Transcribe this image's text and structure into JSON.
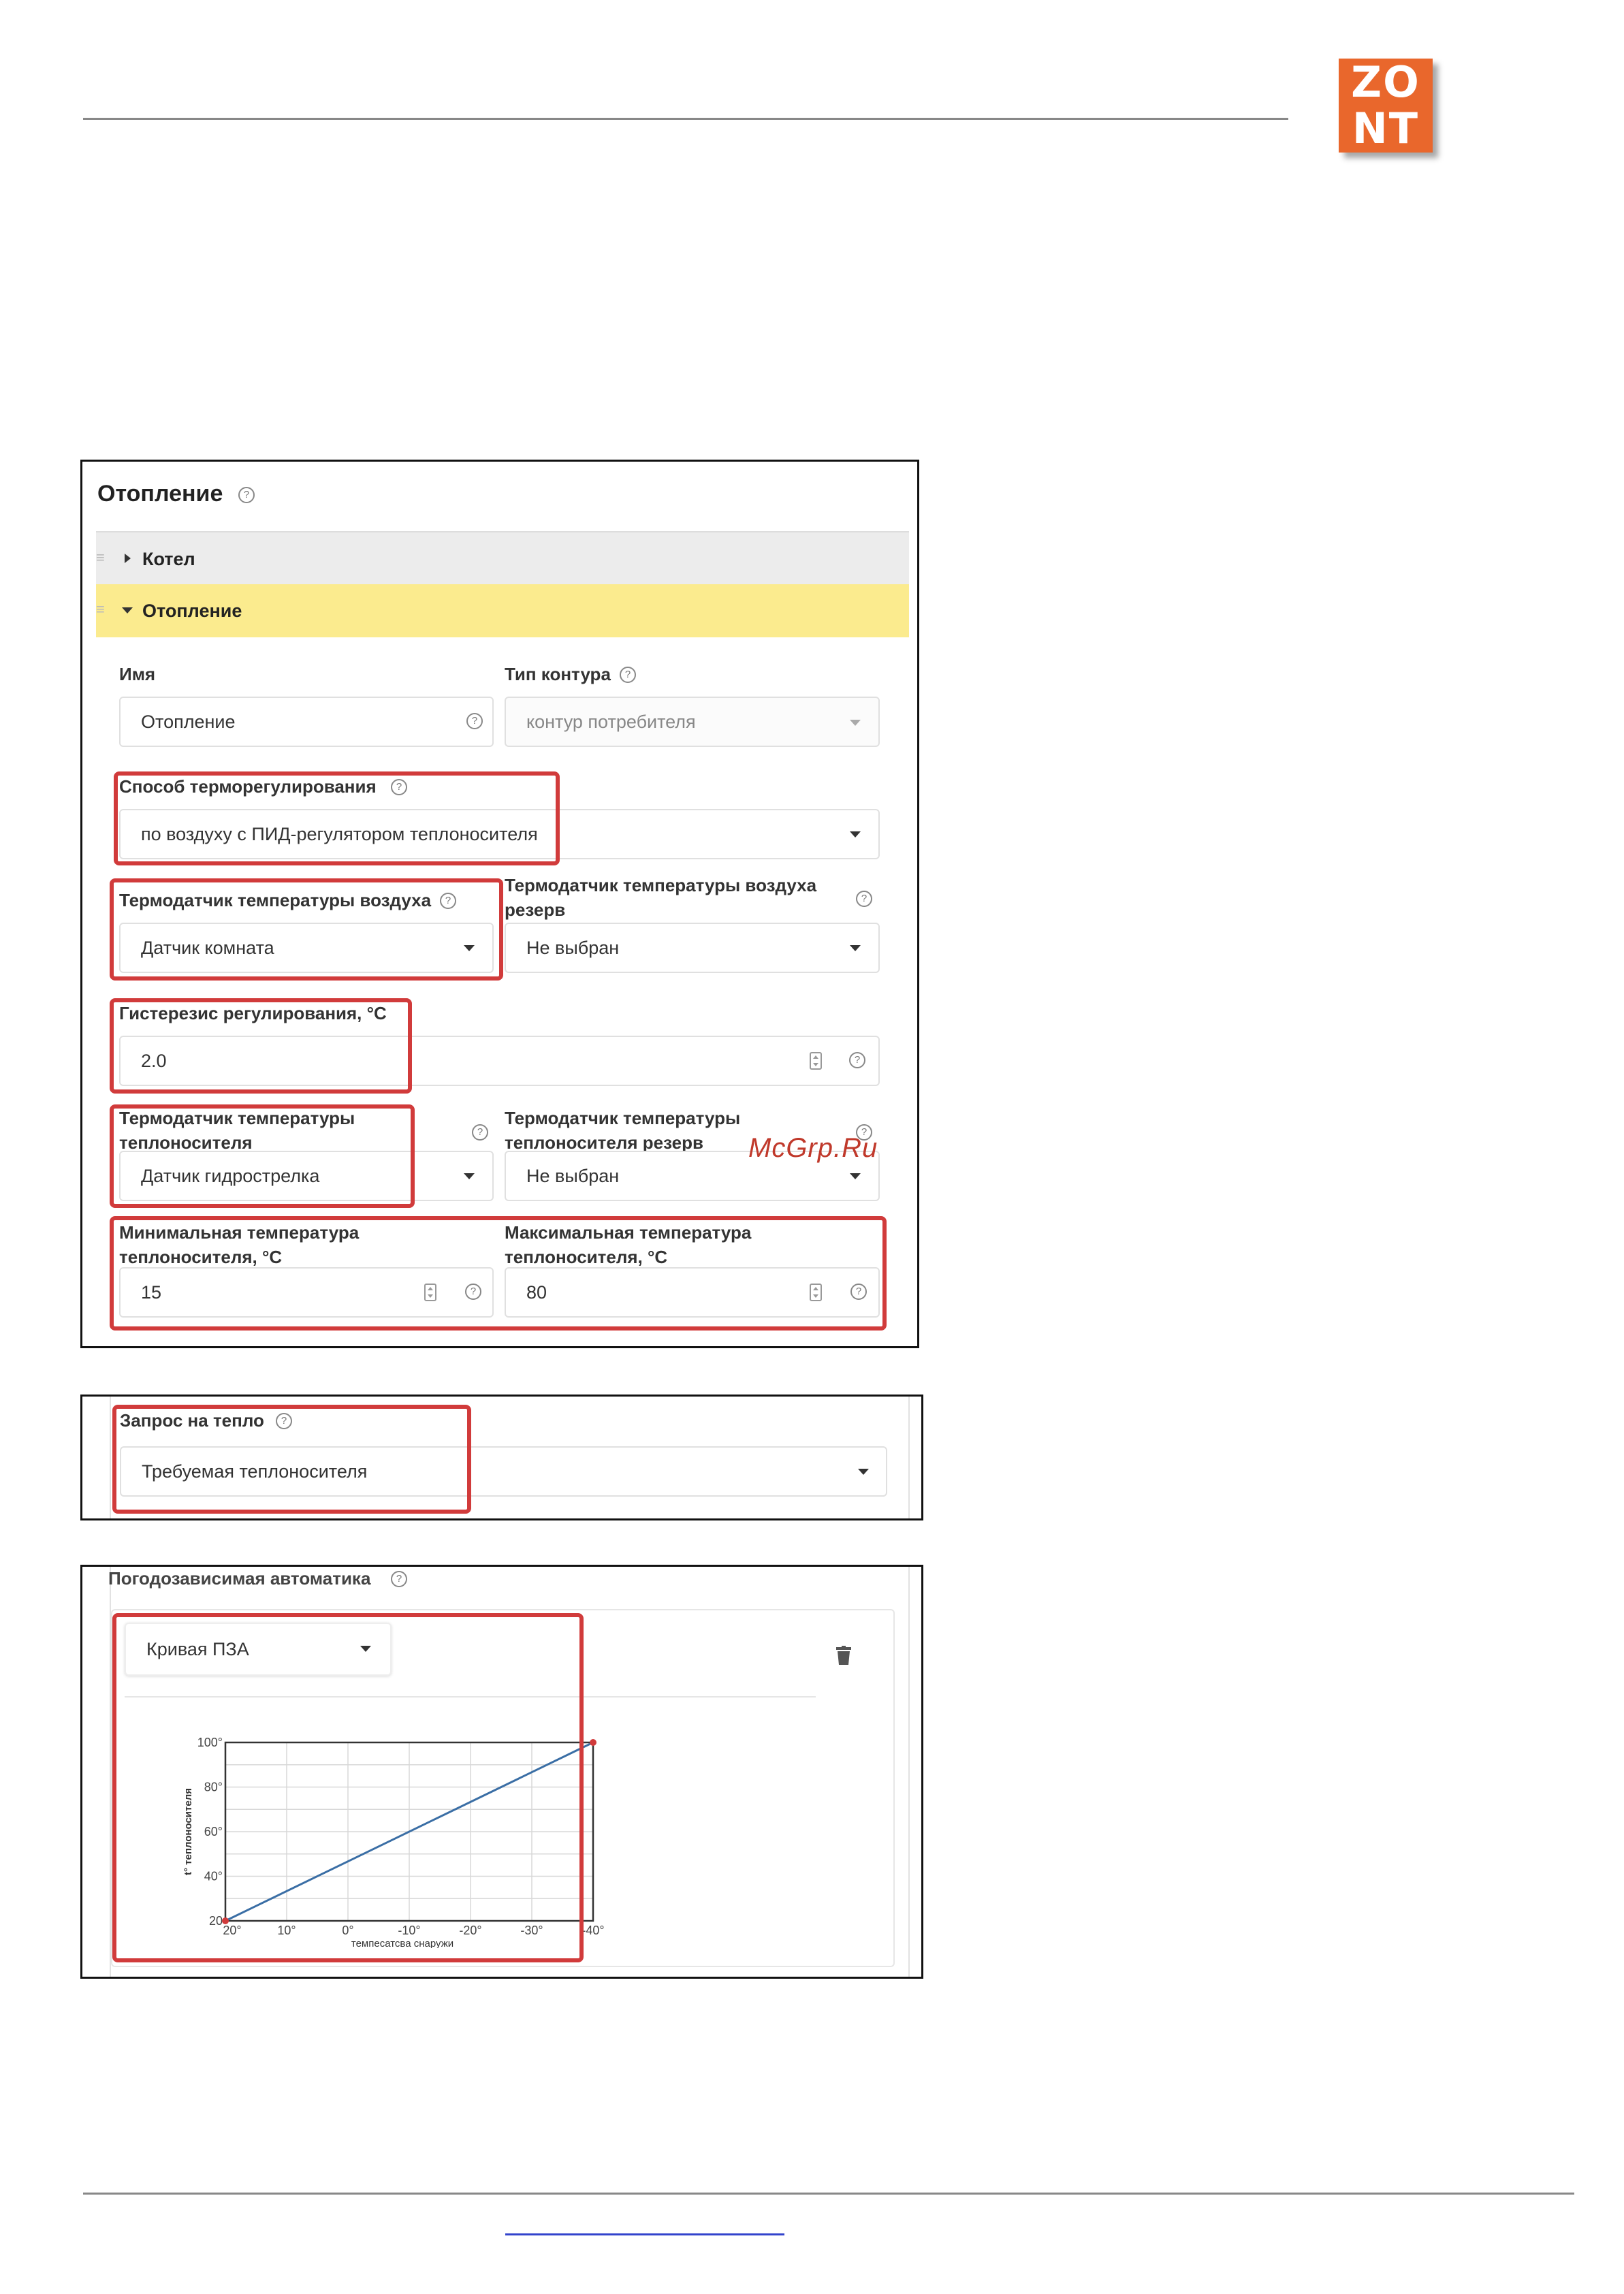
{
  "logo": {
    "line1": "ZO",
    "line2": "NT"
  },
  "watermark": "McGrp.Ru",
  "heating": {
    "title": "Отопление",
    "accordion": [
      {
        "label": "Котел",
        "expanded": false
      },
      {
        "label": "Отопление",
        "expanded": true
      }
    ],
    "name_label": "Имя",
    "name_value": "Отопление",
    "circuit_type_label": "Тип контура",
    "circuit_type_value": "контур потребителя",
    "regulation_method_label": "Способ терморегулирования",
    "regulation_method_value": "по воздуху с ПИД-регулятором теплоносителя",
    "air_sensor_label": "Термодатчик температуры воздуха",
    "air_sensor_value": "Датчик комната",
    "air_sensor_reserve_label_1": "Термодатчик температуры воздуха",
    "air_sensor_reserve_label_2": "резерв",
    "air_sensor_reserve_value": "Не выбран",
    "hysteresis_label": "Гистерезис регулирования, °С",
    "hysteresis_value": "2.0",
    "coolant_sensor_label_1": "Термодатчик температуры",
    "coolant_sensor_label_2": "теплоносителя",
    "coolant_sensor_value": "Датчик гидрострелка",
    "coolant_sensor_reserve_label_1": "Термодатчик температуры",
    "coolant_sensor_reserve_label_2": "теплоносителя резерв",
    "coolant_sensor_reserve_value": "Не выбран",
    "min_temp_label_1": "Минимальная температура",
    "min_temp_label_2": "теплоносителя, °С",
    "min_temp_value": "15",
    "max_temp_label_1": "Максимальная температура",
    "max_temp_label_2": "теплоносителя, °С",
    "max_temp_value": "80"
  },
  "heat_request": {
    "label": "Запрос на тепло",
    "value": "Требуемая теплоносителя"
  },
  "weather": {
    "title": "Погодозависимая автоматика",
    "curve_select": "Кривая ПЗА",
    "delete_icon": "trash-icon"
  },
  "chart_data": {
    "type": "line",
    "title": "",
    "xlabel": "темпесатсва снаружи",
    "ylabel": "t° теплоносителя",
    "x_ticks": [
      "20°",
      "10°",
      "0°",
      "-10°",
      "-20°",
      "-30°",
      "-40°"
    ],
    "y_ticks": [
      "100°",
      "80°",
      "60°",
      "40°",
      "20"
    ],
    "xlim": [
      20,
      -40
    ],
    "ylim": [
      20,
      100
    ],
    "grid": true,
    "series": [
      {
        "x": [
          20,
          -40
        ],
        "y": [
          20,
          100
        ]
      }
    ],
    "line_color": "#3a6ea5",
    "point_color": "#d13b3b"
  }
}
